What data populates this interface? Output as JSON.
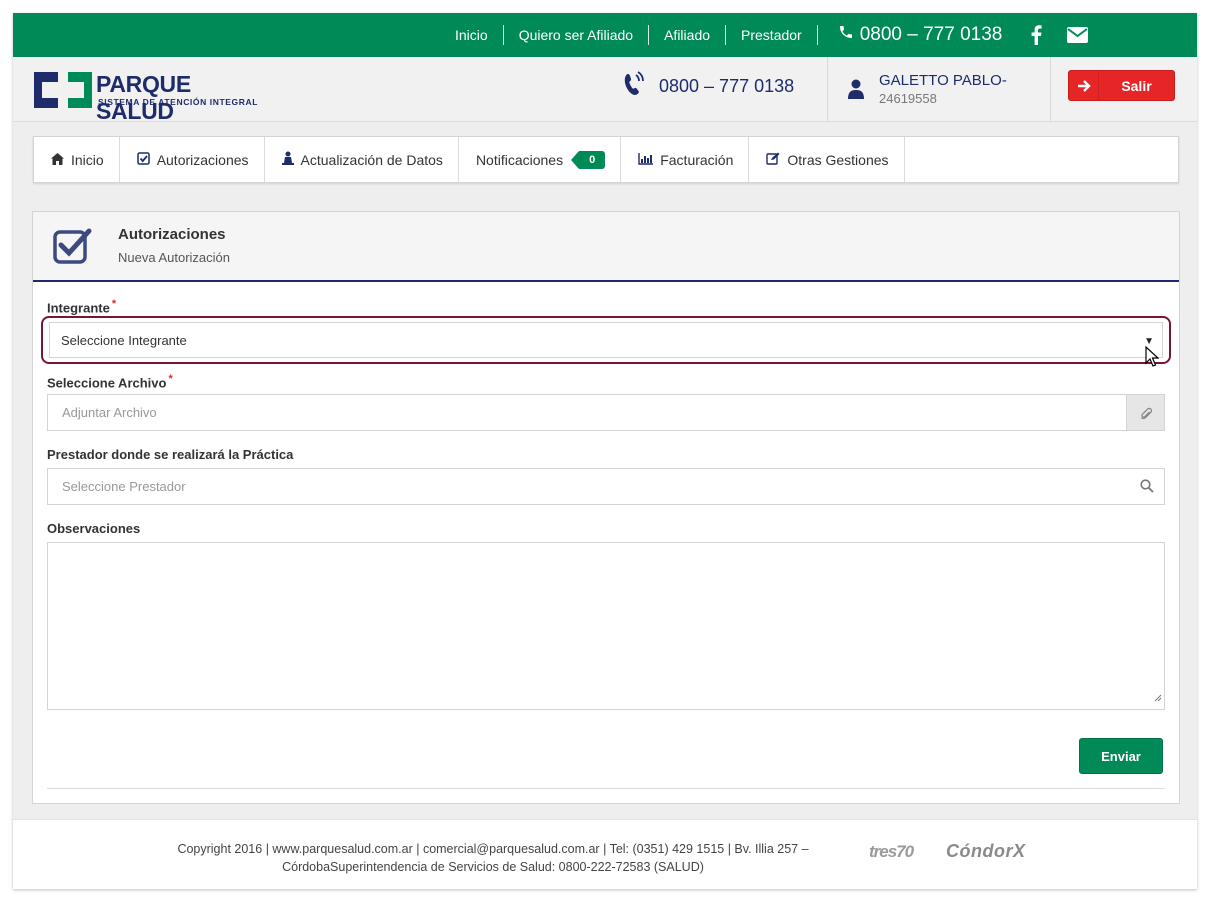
{
  "topbar": {
    "nav": [
      "Inicio",
      "Quiero ser Afiliado",
      "Afiliado",
      "Prestador"
    ],
    "phone": "0800 – 777 0138",
    "icons": [
      "facebook-icon",
      "envelope-icon"
    ]
  },
  "header": {
    "logo_name": "PARQUE SALUD",
    "logo_sub": "SISTEMA DE ATENCIÓN INTEGRAL",
    "phone": "0800 – 777 0138",
    "user_name": "GALETTO PABLO-",
    "user_id": "24619558",
    "logout_label": "Salir"
  },
  "menu": {
    "items": [
      {
        "label": "Inicio",
        "icon": "home-icon"
      },
      {
        "label": "Autorizaciones",
        "icon": "check-square-icon"
      },
      {
        "label": "Actualización de Datos",
        "icon": "person-icon"
      },
      {
        "label": "Notificaciones",
        "icon": ""
      },
      {
        "label": "Facturación",
        "icon": "bar-chart-icon"
      },
      {
        "label": "Otras Gestiones",
        "icon": "edit-icon"
      }
    ],
    "notifications_count": "0"
  },
  "panel": {
    "title": "Autorizaciones",
    "subtitle": "Nueva Autorización",
    "fields": {
      "integrante_label": "Integrante",
      "integrante_value": "Seleccione Integrante",
      "archivo_label": "Seleccione Archivo",
      "archivo_placeholder": "Adjuntar Archivo",
      "prestador_label": "Prestador donde se realizará la Práctica",
      "prestador_placeholder": "Seleccione Prestador",
      "observaciones_label": "Observaciones",
      "required_mark": "*"
    },
    "submit_label": "Enviar"
  },
  "footer": {
    "line1": "Copyright 2016 | www.parquesalud.com.ar | comercial@parquesalud.com.ar | Tel: (0351) 429 1515 | Bv. Illia 257 –",
    "line2": "CórdobaSuperintendencia de Servicios de Salud: 0800-222-72583 (SALUD)",
    "brand1": "tres70",
    "brand2": "CóndorX"
  },
  "colors": {
    "brand_green": "#008a57",
    "brand_navy": "#1e2c6b",
    "danger_red": "#e62626",
    "focus_border": "#7a1530"
  }
}
